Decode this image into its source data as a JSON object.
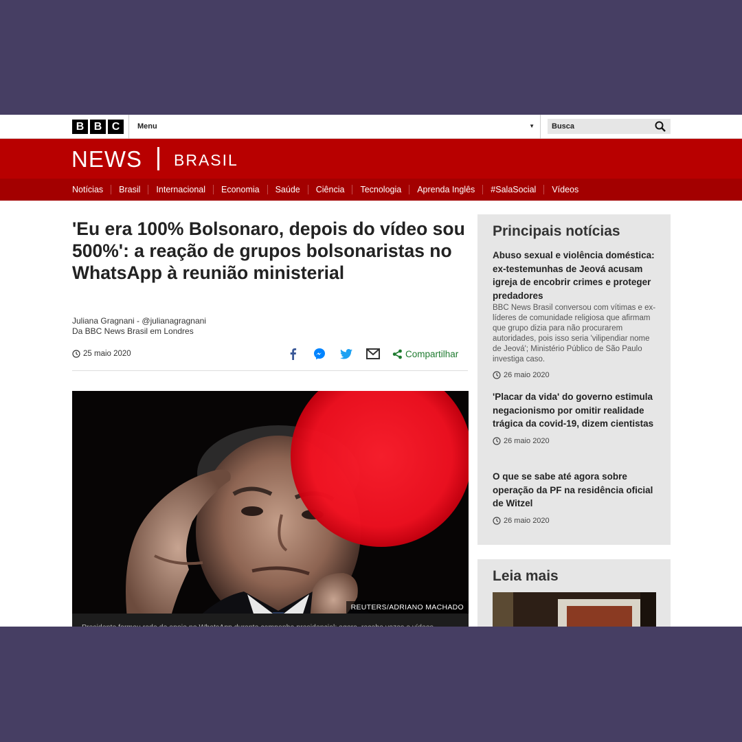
{
  "topbar": {
    "logo_letters": [
      "B",
      "B",
      "C"
    ],
    "menu_label": "Menu",
    "search_label": "Busca"
  },
  "header": {
    "brand": "NEWS",
    "edition": "BRASIL",
    "nav": [
      "Notícias",
      "Brasil",
      "Internacional",
      "Economia",
      "Saúde",
      "Ciência",
      "Tecnologia",
      "Aprenda Inglês",
      "#SalaSocial",
      "Vídeos"
    ]
  },
  "article": {
    "headline": "'Eu era 100% Bolsonaro, depois do vídeo sou 500%': a reação de grupos bolsonaristas no WhatsApp à reunião ministerial",
    "author": "Juliana Gragnani - @julianagragnani",
    "location": "Da BBC News Brasil em Londres",
    "date": "25 maio 2020",
    "share_label": "Compartilhar",
    "photo_credit": "REUTERS/ADRIANO MACHADO",
    "caption": "Presidente formou rede de apoio no WhatsApp durante campanha presidencial; agora, recebe vozes e vídeos"
  },
  "sidebar": {
    "title": "Principais notícias",
    "stories": [
      {
        "title": "Abuso sexual e violência doméstica: ex-testemunhas de Jeová acusam igreja de encobrir crimes e proteger predadores",
        "summary": "BBC News Brasil conversou com vítimas e ex-líderes de comunidade religiosa que afirmam que grupo dizia para não procurarem autoridades, pois isso seria 'vilipendiar nome de Jeová'; Ministério Público de São Paulo investiga caso.",
        "date": "26 maio 2020"
      },
      {
        "title": "'Placar da vida' do governo estimula negacionismo por omitir realidade trágica da covid-19, dizem cientistas",
        "summary": "",
        "date": "26 maio 2020"
      },
      {
        "title": "O que se sabe até agora sobre operação da PF na residência oficial de Witzel",
        "summary": "",
        "date": "26 maio 2020"
      }
    ],
    "more_title": "Leia mais"
  },
  "colors": {
    "frame": "#463e63",
    "brand_red": "#b80000",
    "nav_red": "#a30000",
    "share_green": "#1d7a2e",
    "facebook": "#3b5998",
    "messenger": "#0084ff",
    "twitter": "#1da1f2"
  },
  "icons": [
    "search-icon",
    "clock-icon",
    "facebook-icon",
    "messenger-icon",
    "twitter-icon",
    "email-icon",
    "share-icon",
    "chevron-down-icon"
  ]
}
